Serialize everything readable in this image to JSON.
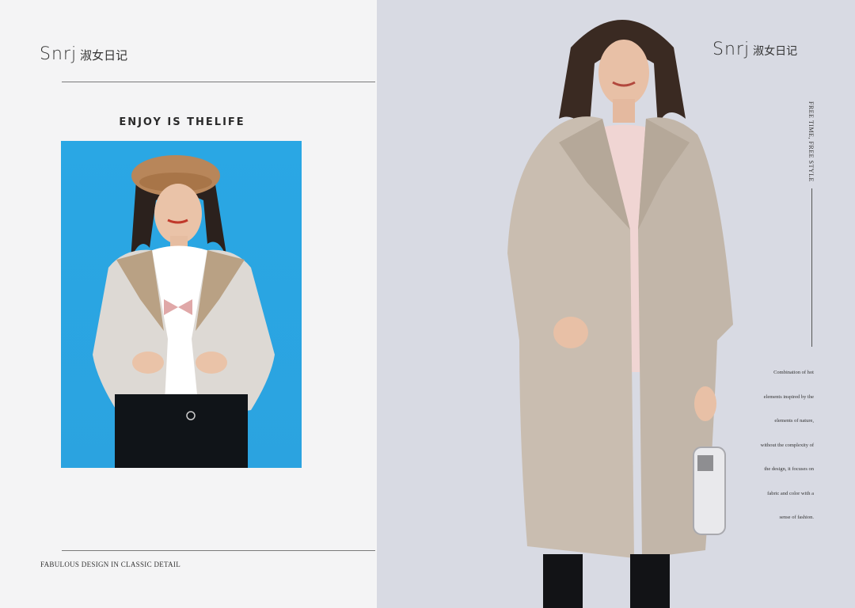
{
  "left_page": {
    "brand_latin": "Snrj",
    "brand_cjk": "淑女日记",
    "headline": "ENJOY IS THELIFE",
    "footer": "FABULOUS DESIGN IN CLASSIC DETAIL"
  },
  "right_page": {
    "brand_latin": "Snrj",
    "brand_cjk": "淑女日记",
    "vertical_tag": "FREE TIME, FREE STYLE",
    "body_lines": [
      "Combination of hot",
      "elements inspired by the",
      "elements of nature,",
      "without the complexity of",
      "the design, it focuses on",
      "fabric and color with a",
      "sense of fashion."
    ]
  },
  "colors": {
    "left_background": "#f4f4f5",
    "photo_background": "#2ba3e0",
    "right_background": "#d8dae3",
    "coat": "#c9bdb0"
  }
}
